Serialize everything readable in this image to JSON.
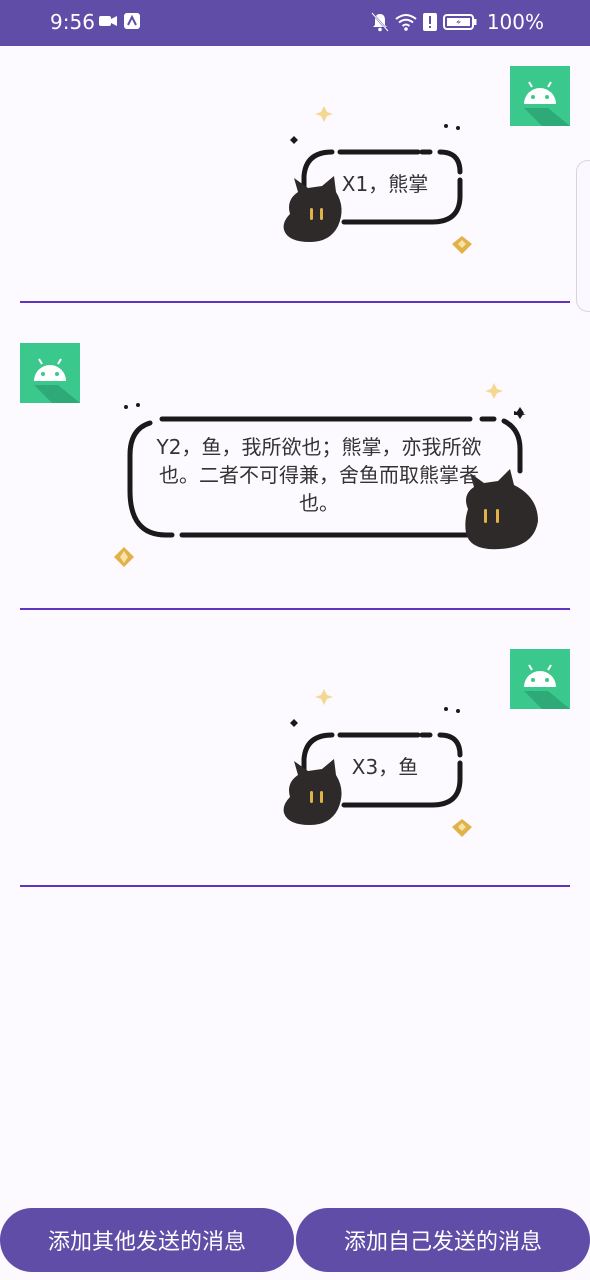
{
  "status_bar": {
    "time": "9:56",
    "battery": "100%",
    "icons": [
      "video-camera-icon",
      "app-notification-icon",
      "bell-off-icon",
      "wifi-icon",
      "alert-icon",
      "battery-icon"
    ]
  },
  "messages": [
    {
      "side": "right",
      "avatar_icon": "android-icon",
      "text": "X1，熊掌"
    },
    {
      "side": "left",
      "avatar_icon": "android-icon",
      "text": "Y2，鱼，我所欲也；熊掌，亦我所欲也。二者不可得兼，舍鱼而取熊掌者也。"
    },
    {
      "side": "right",
      "avatar_icon": "android-icon",
      "text": "X3，鱼"
    }
  ],
  "buttons": {
    "add_other": "添加其他发送的消息",
    "add_self": "添加自己发送的消息"
  },
  "colors": {
    "accent": "#5f4da8",
    "divider": "#5f35c0",
    "avatar": "#3ac88c",
    "sparkle": "#e2b24a"
  }
}
